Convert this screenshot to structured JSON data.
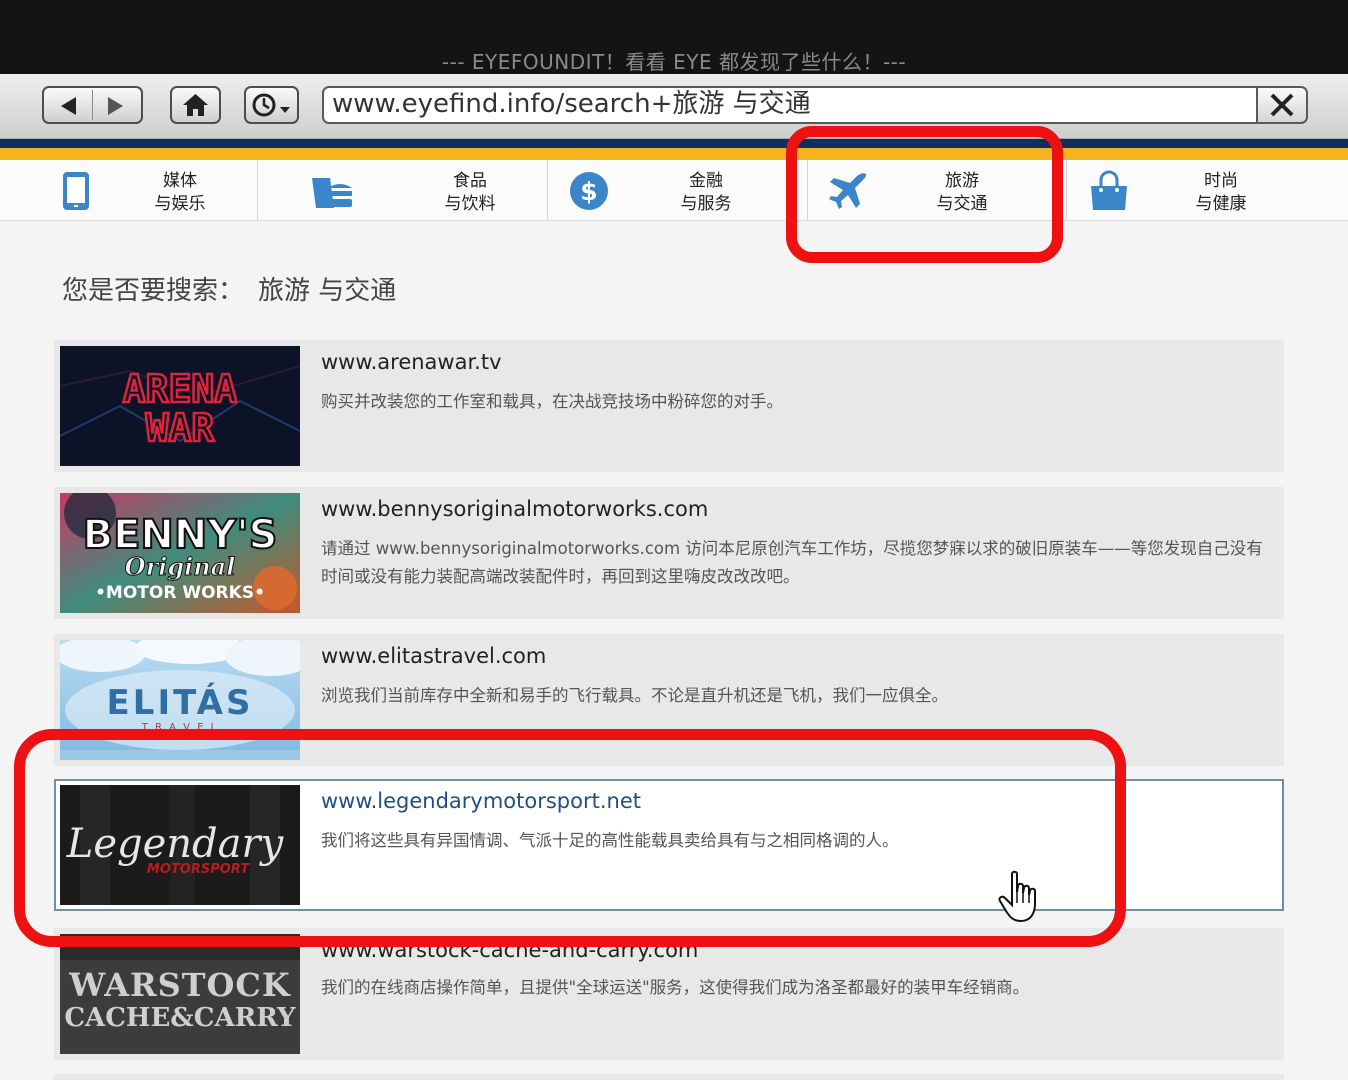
{
  "window": {
    "title": "--- EYEFOUNDIT！看看 EYE 都发现了些什么！---"
  },
  "address_bar": {
    "url": "www.eyefind.info/search+旅游 与交通"
  },
  "categories": [
    {
      "line1": "媒体",
      "line2": "与娱乐",
      "icon": "tablet-icon"
    },
    {
      "line1": "食品",
      "line2": "与饮料",
      "icon": "food-icon"
    },
    {
      "line1": "金融",
      "line2": "与服务",
      "icon": "dollar-icon"
    },
    {
      "line1": "旅游",
      "line2": "与交通",
      "icon": "airplane-icon"
    },
    {
      "line1": "时尚",
      "line2": "与健康",
      "icon": "shopping-bag-icon"
    }
  ],
  "search": {
    "prompt": "您是否要搜索：",
    "term": "旅游 与交通"
  },
  "results": [
    {
      "url": "www.arenawar.tv",
      "desc": "购买并改装您的工作室和载具，在决战竞技场中粉碎您的对手。",
      "logo_lines": [
        "ARENA",
        "WAR"
      ]
    },
    {
      "url": "www.bennysoriginalmotorworks.com",
      "desc": "请通过 www.bennysoriginalmotorworks.com 访问本尼原创汽车工作坊，尽揽您梦寐以求的破旧原装车——等您发现自己没有时间或没有能力装配高端改装配件时，再回到这里嗨皮改改改吧。",
      "logo_lines": [
        "BENNY'S",
        "Original",
        "•MOTOR WORKS•"
      ]
    },
    {
      "url": "www.elitastravel.com",
      "desc": "浏览我们当前库存中全新和易手的飞行载具。不论是直升机还是飞机，我们一应俱全。",
      "logo_lines": [
        "ELITÁS",
        "T R A V E L"
      ]
    },
    {
      "url": "www.legendarymotorsport.net",
      "desc": "我们将这些具有异国情调、气派十足的高性能载具卖给具有与之相同格调的人。",
      "logo_lines": [
        "Legendary",
        "MOTORSPORT"
      ]
    },
    {
      "url": "www.warstock-cache-and-carry.com",
      "desc": "我们的在线商店操作简单，且提供\"全球运送\"服务，这使得我们成为洛圣都最好的装甲车经销商。",
      "logo_lines": [
        "WARSTOCK",
        "CACHE&CARRY"
      ]
    }
  ],
  "colors": {
    "highlight_box": "#ee1111",
    "accent_navy": "#0f2f5e",
    "accent_gold": "#f3b41f",
    "icon_blue": "#3a86c8",
    "link": "#1f4f86"
  }
}
